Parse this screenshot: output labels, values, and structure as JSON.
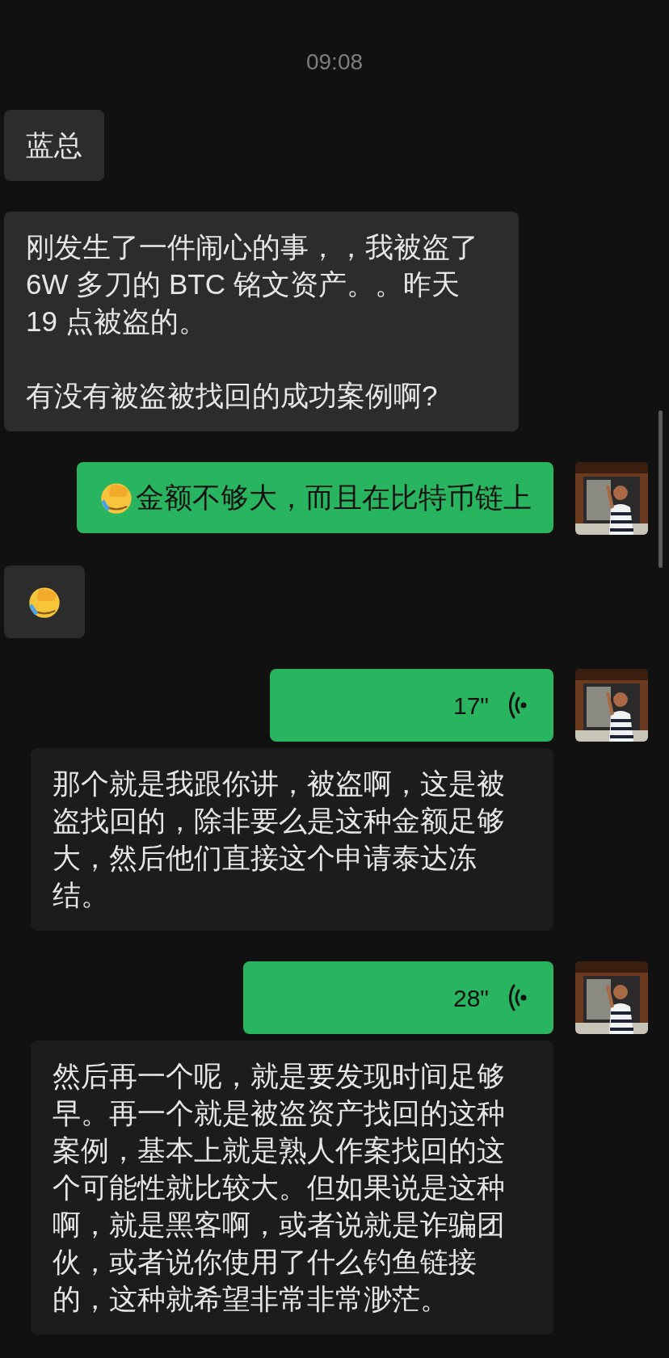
{
  "timestamp": "09:08",
  "messages": [
    {
      "kind": "text",
      "sent": false,
      "paragraphs": [
        "蓝总"
      ]
    },
    {
      "kind": "text",
      "sent": false,
      "paragraphs": [
        "刚发生了一件闹心的事，，我被盗了6W 多刀的 BTC 铭文资产。。昨天 19 点被盗的。",
        "有没有被盗被找回的成功案例啊?"
      ]
    },
    {
      "kind": "text",
      "sent": true,
      "leading_emoji": true,
      "paragraphs": [
        "金额不够大，而且在比特币链上"
      ]
    },
    {
      "kind": "emoji",
      "sent": false
    },
    {
      "kind": "voice",
      "sent": true,
      "duration": "17\""
    },
    {
      "kind": "transcript",
      "sent": true,
      "text": "那个就是我跟你讲，被盗啊，这是被盗找回的，除非要么是这种金额足够大，然后他们直接这个申请泰达冻结。"
    },
    {
      "kind": "voice",
      "sent": true,
      "duration": "28\""
    },
    {
      "kind": "transcript",
      "sent": true,
      "text": "然后再一个呢，就是要发现时间足够早。再一个就是被盗资产找回的这种案例，基本上就是熟人作案找回的这个可能性就比较大。但如果说是这种啊，就是黑客啊，或者说就是诈骗团伙，或者说你使用了什么钓鱼链接的，这种就希望非常非常渺茫。"
    }
  ]
}
